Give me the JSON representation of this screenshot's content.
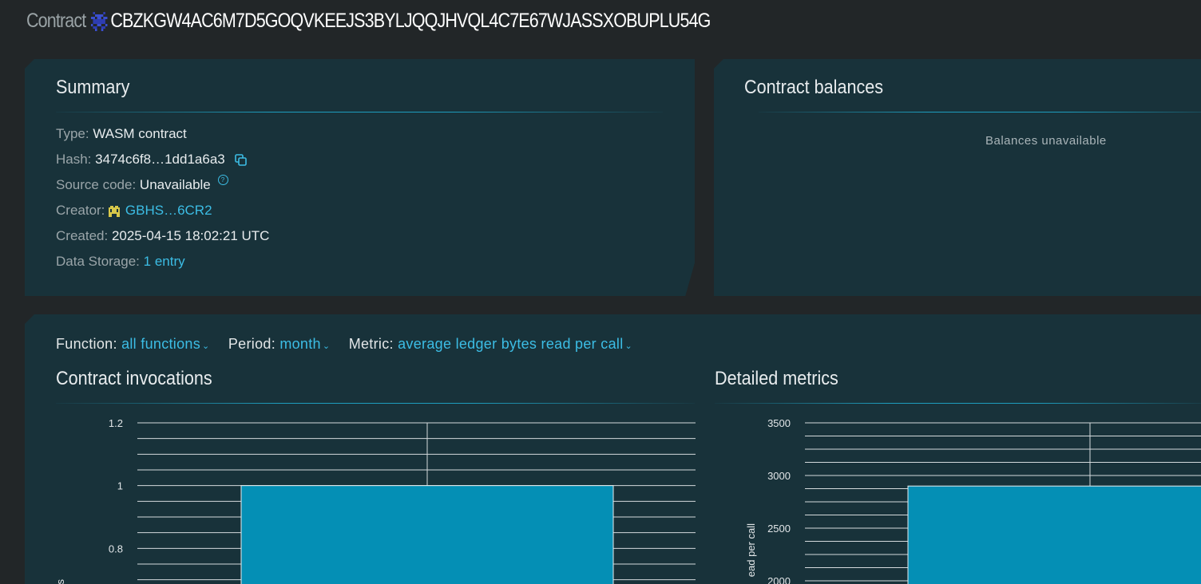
{
  "header": {
    "label": "Contract",
    "address": "CBZKGW4AC6M7D5GOQVKEEJS3BYLJQQJHVQL4C7E67WJASSXOBUPLU54G"
  },
  "summary": {
    "title": "Summary",
    "type_label": "Type:",
    "type_value": "WASM contract",
    "hash_label": "Hash:",
    "hash_value": "3474c6f8…1dd1a6a3",
    "source_label": "Source code:",
    "source_value": "Unavailable",
    "creator_label": "Creator:",
    "creator_value": "GBHS…6CR2",
    "created_label": "Created:",
    "created_value": "2025-04-15 18:02:21 UTC",
    "storage_label": "Data Storage:",
    "storage_value": "1 entry"
  },
  "balances": {
    "title": "Contract balances",
    "empty_text": "Balances unavailable"
  },
  "filters": {
    "function_label": "Function:",
    "function_value": "all functions",
    "period_label": "Period:",
    "period_value": "month",
    "metric_label": "Metric:",
    "metric_value": "average ledger bytes read per call"
  },
  "colors": {
    "accent": "#3cbde5",
    "bar": "#048fb5",
    "panel": "#18323a",
    "background": "#222628"
  },
  "chart_data": [
    {
      "type": "bar",
      "title": "Contract invocations",
      "ylabel": "ics",
      "ylim": [
        0.6,
        1.2
      ],
      "y_ticks": [
        "0.8",
        "1",
        "1.2"
      ],
      "series": [
        {
          "values": [
            1
          ]
        }
      ],
      "grid": true
    },
    {
      "type": "bar",
      "title": "Detailed metrics",
      "ylabel": "ead per call",
      "ylim": [
        2000,
        3500
      ],
      "y_ticks": [
        "2000",
        "2500",
        "3000",
        "3500"
      ],
      "series": [
        {
          "values": [
            2900
          ]
        }
      ],
      "grid": true
    }
  ]
}
